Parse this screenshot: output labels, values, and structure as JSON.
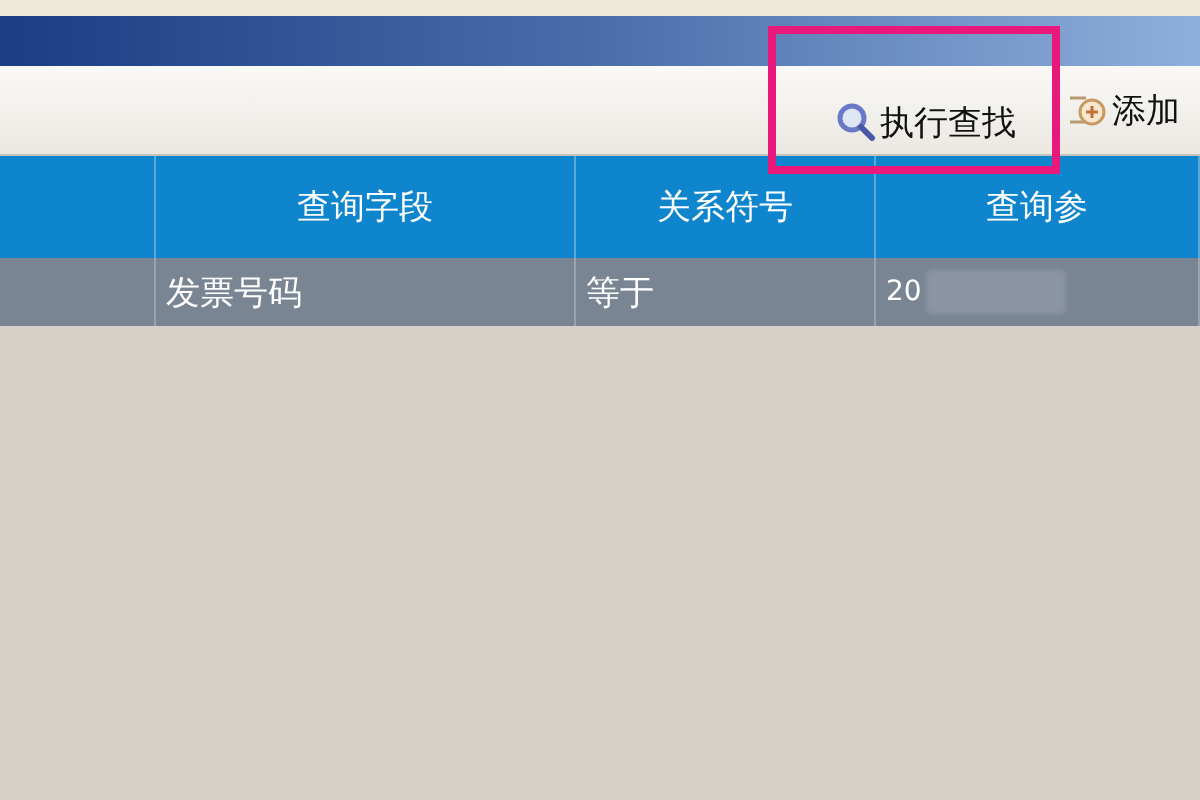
{
  "toolbar": {
    "buttons": [
      {
        "label": "执行查找",
        "kind": "search",
        "highlighted": true
      },
      {
        "label": "添加",
        "kind": "add",
        "highlighted": false
      }
    ]
  },
  "table": {
    "columns": [
      "",
      "查询字段",
      "关系符号",
      "查询参"
    ],
    "rows": [
      {
        "selected": true,
        "cells": [
          "",
          "发票号码",
          "等于",
          "20"
        ],
        "redacted": true
      }
    ]
  }
}
